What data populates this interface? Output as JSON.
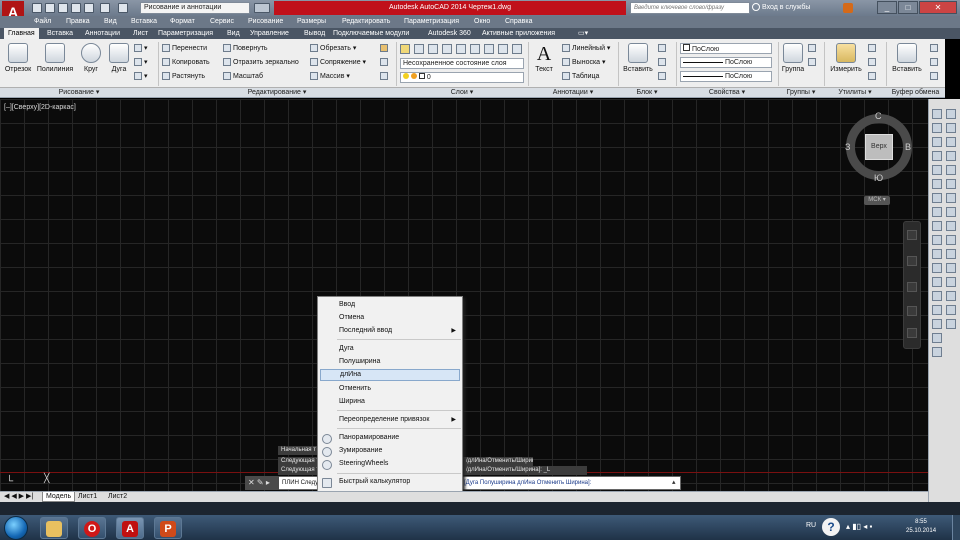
{
  "app": {
    "window_title": "Autodesk AutoCAD 2014   Чертеж1.dwg",
    "workspace": "Рисование и аннотации",
    "search_placeholder": "Введите ключевое слово/фразу",
    "sign_in": "Вход в службы",
    "window_buttons": [
      "_",
      "□",
      "✕"
    ]
  },
  "menubar": [
    "Файл",
    "Правка",
    "Вид",
    "Вставка",
    "Формат",
    "Сервис",
    "Рисование",
    "Размеры",
    "Редактировать",
    "Параметризация",
    "Окно",
    "Справка"
  ],
  "ribbon_tabs": [
    "Главная",
    "Вставка",
    "Аннотации",
    "Лист",
    "Параметризация",
    "Вид",
    "Управление",
    "Вывод",
    "Подключаемые модули",
    "Autodesk 360",
    "Активные приложения",
    "▭▾"
  ],
  "ribbon": {
    "draw": {
      "line": "Отрезок",
      "polyline": "Полилиния",
      "circle": "Круг",
      "arc": "Дуга"
    },
    "modify": {
      "move": "Перенести",
      "rotate": "Повернуть",
      "trim": "Обрезать",
      "copy": "Копировать",
      "mirror": "Отразить зеркально",
      "fillet": "Сопряжение",
      "stretch": "Растянуть",
      "scale": "Масштаб",
      "array": "Массив"
    },
    "layers": {
      "state": "Несохраненное состояние слоя",
      "current": "0"
    },
    "annotation": {
      "text": "Текст",
      "linear": "Линейный",
      "leader": "Выноска",
      "table": "Таблица"
    },
    "block": {
      "insert": "Вставить"
    },
    "properties": {
      "color": "ПоСлою",
      "linetype": "ПоСлою",
      "lineweight": "ПоСлою"
    },
    "groups": {
      "group": "Группа"
    },
    "utilities": {
      "measure": "Измерить"
    },
    "clipboard": {
      "paste": "Вставить"
    }
  },
  "panel_labels": [
    "Рисование ▾",
    "Редактирование ▾",
    "Слои ▾",
    "Аннотации ▾",
    "Блок ▾",
    "Свойства ▾",
    "Группы ▾",
    "Утилиты ▾",
    "Буфер обмена"
  ],
  "viewport_label": "[–][Сверху][2D-каркас]",
  "viewcube": {
    "top": "Верх",
    "north": "С",
    "south": "Ю",
    "east": "В",
    "west": "З",
    "wcs": "МСК ▾"
  },
  "context_menu": {
    "items": [
      {
        "label": "Ввод",
        "submenu": false
      },
      {
        "label": "Отмена",
        "submenu": false
      },
      {
        "label": "Последний ввод",
        "submenu": true
      },
      {
        "label": "Дуга",
        "submenu": false
      },
      {
        "label": "Полуширина",
        "submenu": false
      },
      {
        "label": "длИна",
        "submenu": false,
        "highlighted": true
      },
      {
        "label": "Отменить",
        "submenu": false
      },
      {
        "label": "Ширина",
        "submenu": false
      },
      {
        "label": "Переопределение привязок",
        "submenu": true
      },
      {
        "label": "Панорамирование",
        "icon": "pan-icon"
      },
      {
        "label": "Зумирование",
        "icon": "zoom-icon"
      },
      {
        "label": "SteeringWheels",
        "icon": "steeringwheel-icon"
      },
      {
        "label": "Быстрый калькулятор",
        "icon": "calculator-icon"
      }
    ]
  },
  "command_history": [
    "Начальная т",
    "Следующая т Дуга/Полуширина/длИна/Отменить/Ширина]:",
    "Следующая т Дуга/Полуширина/длИна/Отменить/Ширина]:"
  ],
  "command_line": {
    "prompt": "ПЛИН Следующая точка или",
    "options": "[Дуга Полуширина длИна Отменить Ширина]:"
  },
  "layout_tabs": [
    "Модель",
    "Лист1",
    "Лист2"
  ],
  "tray": {
    "language": "RU",
    "time": "8:55",
    "date": "25.10.2014"
  }
}
